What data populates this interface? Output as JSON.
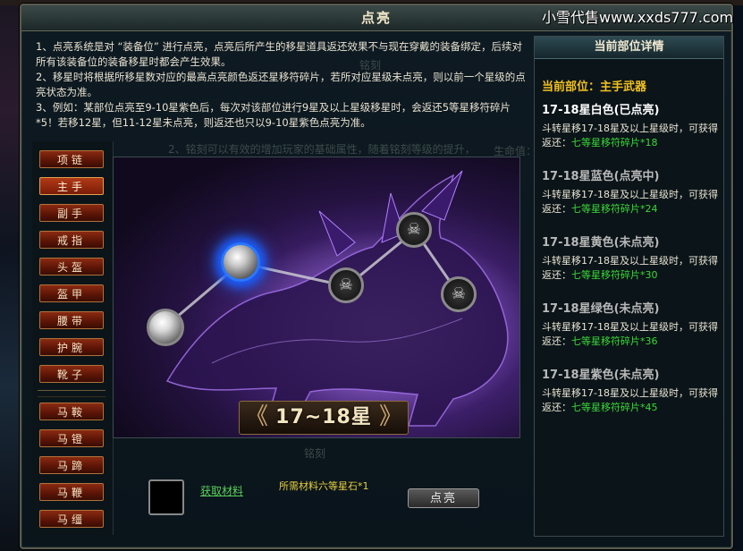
{
  "window": {
    "title": "点亮",
    "close_label": "×",
    "watermark": "小雪代售www.xxds777.com"
  },
  "intro": [
    "1、点亮系统是对 “装备位” 进行点亮，点亮后所产生的移星道具返还效果不与现在穿戴的装备绑定，后续对所有该装备位的装备移星时都会产生效果。",
    "2、移星时将根据所移星数对应的最高点亮颜色返还星移符碎片，若所对应星级未点亮，则以前一个星级的点亮状态为准。",
    "3、例如：某部位点亮至9-10星紫色后，每次对该部位进行9星及以上星级移星时，会返还5等星移符碎片*5！若移12星，但11-12星未点亮，则返还也只以9-10星紫色点亮为准。"
  ],
  "ghost_text": {
    "tab": "铭刻",
    "line": "2、铭刻可以有效的增加玩家的基础属性，随着铭刻等级的提升，",
    "hp_label": "生命值：",
    "bottom_tab": "铭刻"
  },
  "slots": [
    {
      "label": "项链",
      "active": false
    },
    {
      "label": "主手",
      "active": true
    },
    {
      "label": "副手",
      "active": false
    },
    {
      "label": "戒指",
      "active": false
    },
    {
      "label": "头盔",
      "active": false
    },
    {
      "label": "盔甲",
      "active": false
    },
    {
      "label": "腰带",
      "active": false
    },
    {
      "label": "护腕",
      "active": false
    },
    {
      "label": "靴子",
      "active": false
    },
    {
      "label": "马鞍",
      "active": false
    },
    {
      "label": "马镫",
      "active": false
    },
    {
      "label": "马蹄",
      "active": false
    },
    {
      "label": "马鞭",
      "active": false
    },
    {
      "label": "马缰",
      "active": false
    }
  ],
  "stage": {
    "label": "17~18星",
    "prev_arrow": "《",
    "next_arrow": "》",
    "nodes": [
      {
        "state": "lit"
      },
      {
        "state": "active"
      },
      {
        "state": "locked"
      },
      {
        "state": "locked"
      },
      {
        "state": "locked"
      }
    ],
    "lock_glyph": "☠"
  },
  "material": {
    "get_link": "获取材料",
    "required": "所需材料六等星石*1",
    "light_button": "点亮"
  },
  "detail": {
    "header": "当前部位详情",
    "current_part": "当前部位：主手武器",
    "tiers": [
      {
        "name": "17-18星白色(已点亮)",
        "color": "#ffffff",
        "desc": "斗转星移17-18星及以上星级时，可获得返还：",
        "reward": "七等星移符碎片*18"
      },
      {
        "name": "17-18星蓝色(点亮中)",
        "color": "#b8b8b8",
        "desc": "斗转星移17-18星及以上星级时，可获得返还：",
        "reward": "七等星移符碎片*24"
      },
      {
        "name": "17-18星黄色(未点亮)",
        "color": "#b8b8b8",
        "desc": "斗转星移17-18星及以上星级时，可获得返还：",
        "reward": "七等星移符碎片*30"
      },
      {
        "name": "17-18星绿色(未点亮)",
        "color": "#b8b8b8",
        "desc": "斗转星移17-18星及以上星级时，可获得返还：",
        "reward": "七等星移符碎片*36"
      },
      {
        "name": "17-18星紫色(未点亮)",
        "color": "#b8b8b8",
        "desc": "斗转星移17-18星及以上星级时，可获得返还：",
        "reward": "七等星移符碎片*45"
      }
    ]
  },
  "colors": {
    "accent_gold": "#f0c020",
    "reward_green": "#3ad83a",
    "active_blue": "#2a78ff"
  }
}
